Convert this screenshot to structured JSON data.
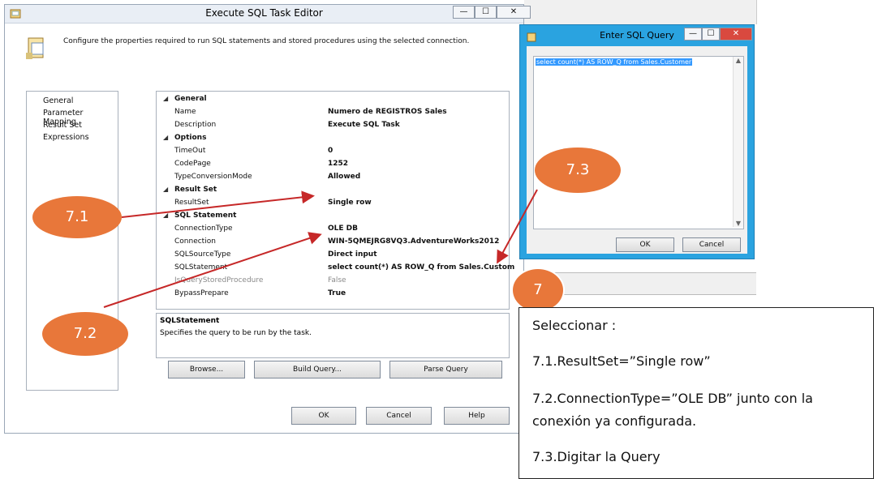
{
  "main_window": {
    "title": "Execute SQL Task Editor",
    "header_text": "Configure the properties required to run SQL statements and stored procedures using the selected connection.",
    "nav_items": [
      "General",
      "Parameter Mapping",
      "Result Set",
      "Expressions"
    ],
    "grid": [
      {
        "type": "category",
        "label": "General"
      },
      {
        "label": "Name",
        "value": "Numero de REGISTROS Sales"
      },
      {
        "label": "Description",
        "value": "Execute SQL Task"
      },
      {
        "type": "category",
        "label": "Options"
      },
      {
        "label": "TimeOut",
        "value": "0"
      },
      {
        "label": "CodePage",
        "value": "1252"
      },
      {
        "label": "TypeConversionMode",
        "value": "Allowed"
      },
      {
        "type": "category",
        "label": "Result Set"
      },
      {
        "label": "ResultSet",
        "value": "Single row"
      },
      {
        "type": "category",
        "label": "SQL Statement"
      },
      {
        "label": "ConnectionType",
        "value": "OLE DB"
      },
      {
        "label": "Connection",
        "value": "WIN-5QMEJRG8VQ3.AdventureWorks2012"
      },
      {
        "label": "SQLSourceType",
        "value": "Direct input"
      },
      {
        "label": "SQLStatement",
        "value": "select  count(*) AS ROW_Q  from Sales.Custom"
      },
      {
        "label": "IsQueryStoredProcedure",
        "value": "False",
        "disabled": true
      },
      {
        "label": "BypassPrepare",
        "value": "True"
      }
    ],
    "desc_title": "SQLStatement",
    "desc_text": "Specifies the query to be run by the task.",
    "buttons": {
      "browse": "Browse...",
      "build": "Build Query...",
      "parse": "Parse Query",
      "ok": "OK",
      "cancel": "Cancel",
      "help": "Help"
    }
  },
  "sql_window": {
    "title": "Enter SQL Query",
    "query": "select  count(*) AS ROW_Q  from Sales.Customer",
    "ok": "OK",
    "cancel": "Cancel"
  },
  "callouts": {
    "c71": "7.1",
    "c72": "7.2",
    "c73": "7.3",
    "c7": "7"
  },
  "note": {
    "line1": "Seleccionar :",
    "line2": "7.1.ResultSet=”Single row”",
    "line3a": "7.2.ConnectionType=”OLE DB” junto con la",
    "line3b": "conexión ya configurada.",
    "line4": "7.3.Digitar la Query"
  },
  "colors": {
    "callout": "#e8773a",
    "arrow": "#c62828",
    "sql_frame": "#2aa3e0",
    "selection": "#3399ff"
  }
}
